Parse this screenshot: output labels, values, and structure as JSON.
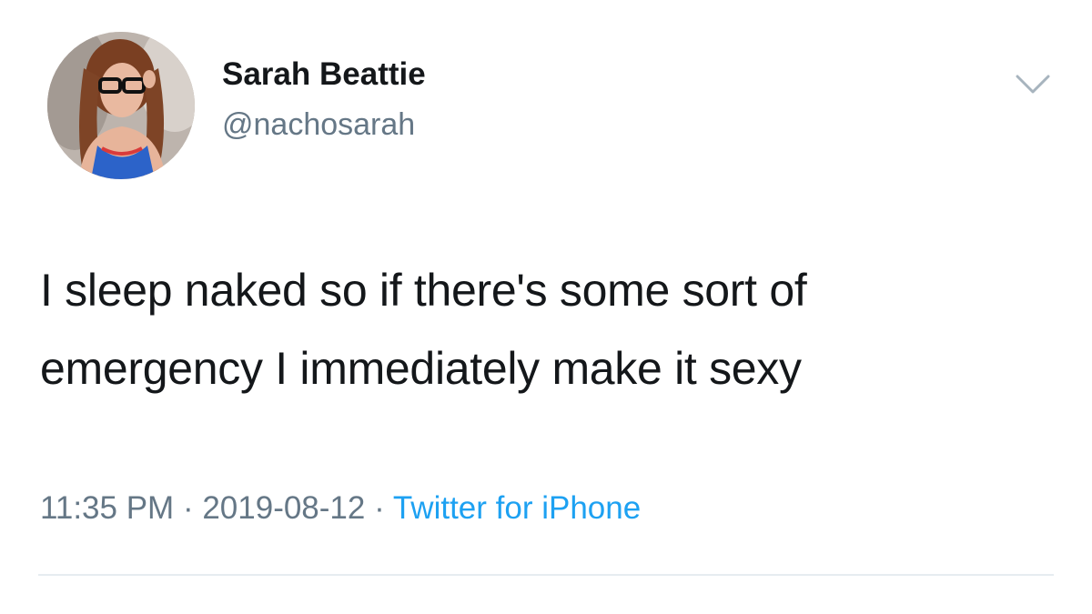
{
  "author": {
    "display_name": "Sarah Beattie",
    "handle": "@nachosarah",
    "avatar_icon": "profile-photo"
  },
  "tweet": {
    "text_lines": [
      "I sleep naked so if there's some sort of",
      "emergency I immediately make it sexy"
    ]
  },
  "meta": {
    "time": "11:35 PM",
    "separator": " · ",
    "date": "2019-08-12",
    "source": "Twitter for iPhone"
  },
  "icons": {
    "menu": "chevron-down-icon"
  },
  "colors": {
    "text": "#14171a",
    "secondary": "#657786",
    "link": "#1da1f2",
    "divider": "#e6ecf0"
  }
}
